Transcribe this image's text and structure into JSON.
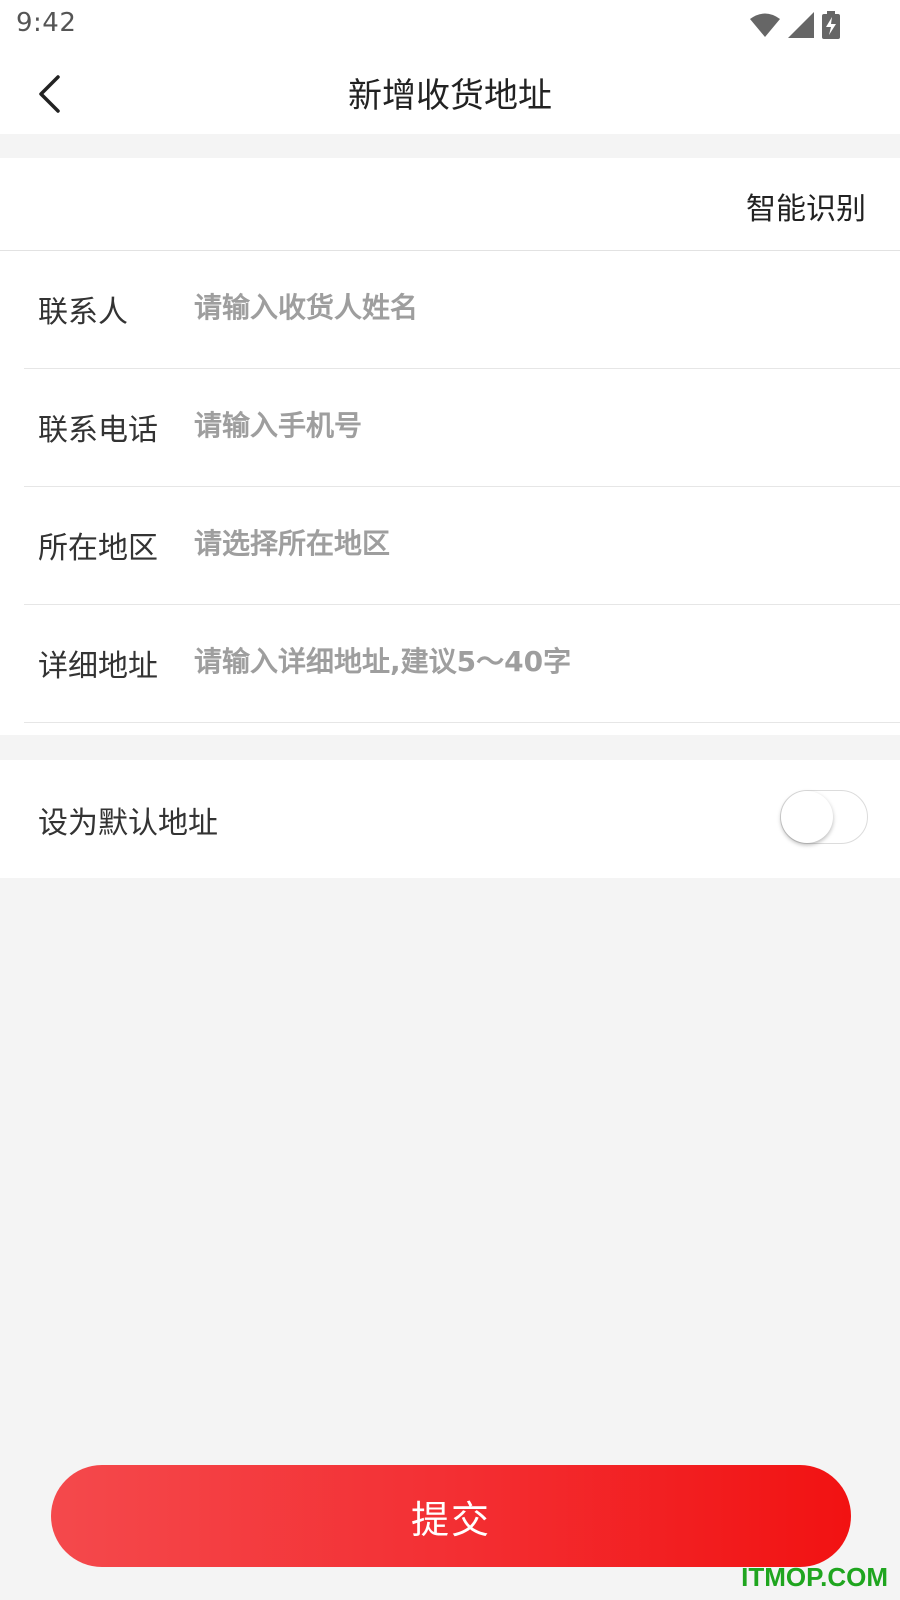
{
  "status_bar": {
    "time": "9:42",
    "icons": [
      "wifi-icon",
      "signal-icon",
      "battery-charging-icon"
    ]
  },
  "header": {
    "title": "新增收货地址",
    "back_icon": "chevron-left-icon"
  },
  "smart_recognize": {
    "label": "智能识别"
  },
  "form": {
    "fields": [
      {
        "label": "联系人",
        "placeholder": "请输入收货人姓名",
        "value": ""
      },
      {
        "label": "联系电话",
        "placeholder": "请输入手机号",
        "value": ""
      },
      {
        "label": "所在地区",
        "placeholder": "请选择所在地区",
        "value": ""
      },
      {
        "label": "详细地址",
        "placeholder": "请输入详细地址,建议5～40字",
        "value": ""
      }
    ]
  },
  "default_address": {
    "label": "设为默认地址",
    "enabled": false
  },
  "submit": {
    "label": "提交"
  },
  "watermark": {
    "text": "ITMOP.COM"
  },
  "colors": {
    "accent_start": "#f4494c",
    "accent_end": "#f21212",
    "page_background": "#f4f4f4",
    "placeholder": "#9e9e9e",
    "watermark": "#1fa51f"
  }
}
